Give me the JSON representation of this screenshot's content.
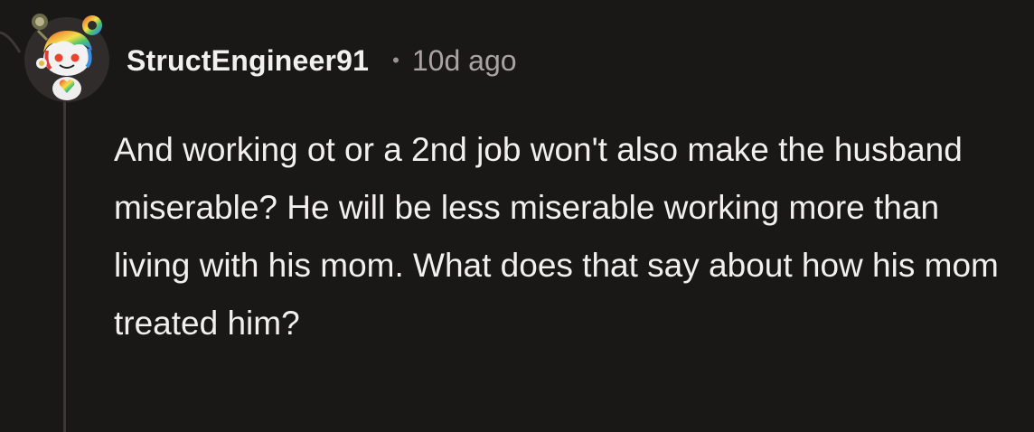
{
  "comment": {
    "author": "StructEngineer91",
    "separator": "•",
    "timestamp": "10d ago",
    "body": "And working ot or a 2nd job won't also make the husband miserable? He will be less miserable working more than living with his mom. What does that say about how his mom treated him?"
  },
  "avatar": {
    "icon": "snoo-avatar-rainbow-hair-icon"
  },
  "colors": {
    "background": "#1a1717",
    "text": "#f2f0ee",
    "meta": "#a9a4a1",
    "thread_line": "#3b3837"
  }
}
